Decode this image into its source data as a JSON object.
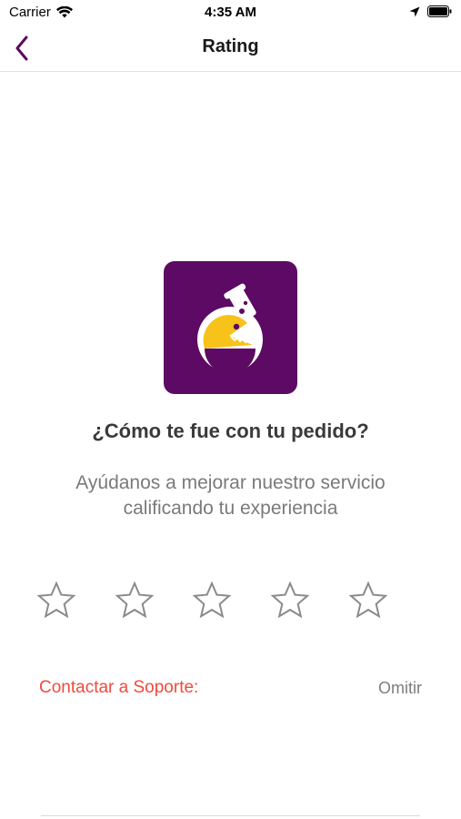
{
  "status_bar": {
    "carrier": "Carrier",
    "time": "4:35 AM"
  },
  "nav": {
    "title": "Rating",
    "back_icon": "chevron-left-icon"
  },
  "content": {
    "question": "¿Cómo te fue con tu pedido?",
    "subtitle_line1": "Ayúdanos a mejorar nuestro servicio",
    "subtitle_line2": "calificando tu experiencia",
    "rating": {
      "max": 5,
      "value": 0
    }
  },
  "actions": {
    "contact_support": "Contactar a Soporte:",
    "skip": "Omitir"
  },
  "colors": {
    "brand_purple": "#5c0a63",
    "accent_yellow": "#f7c21a",
    "link_red": "#f04a3c",
    "star_outline": "#8a8a8a"
  }
}
